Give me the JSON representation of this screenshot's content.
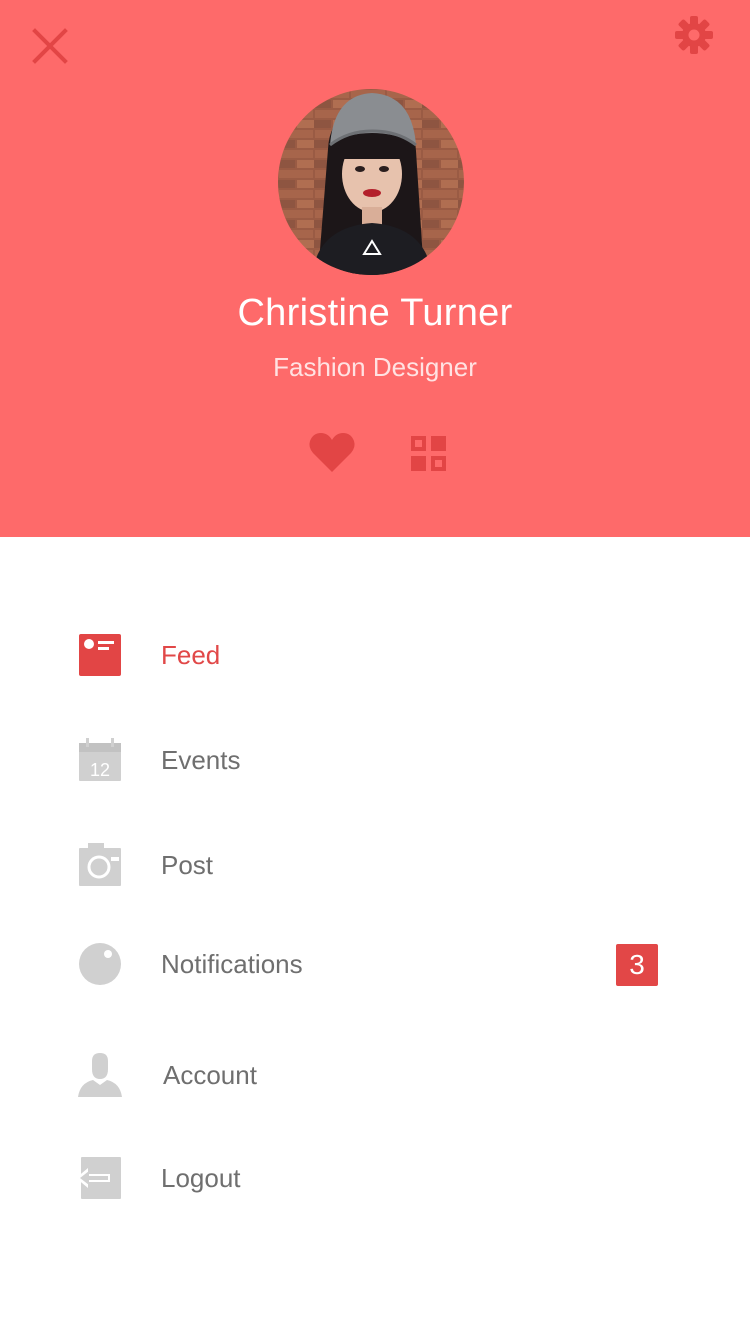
{
  "header": {
    "background": "#fe6a6a",
    "close_icon": "close-icon",
    "settings_icon": "gear-icon"
  },
  "profile": {
    "name": "Christine Turner",
    "role": "Fashion Designer"
  },
  "actions": {
    "like_icon": "heart-icon",
    "qr_icon": "qr-code-icon"
  },
  "menu": {
    "active_color": "#e14848",
    "items": [
      {
        "label": "Feed",
        "icon": "feed-icon",
        "active": true
      },
      {
        "label": "Events",
        "icon": "calendar-icon",
        "icon_text": "12"
      },
      {
        "label": "Post",
        "icon": "camera-icon"
      },
      {
        "label": "Notifications",
        "icon": "notification-icon",
        "badge": "3"
      },
      {
        "label": "Account",
        "icon": "user-icon"
      },
      {
        "label": "Logout",
        "icon": "logout-icon"
      }
    ]
  }
}
